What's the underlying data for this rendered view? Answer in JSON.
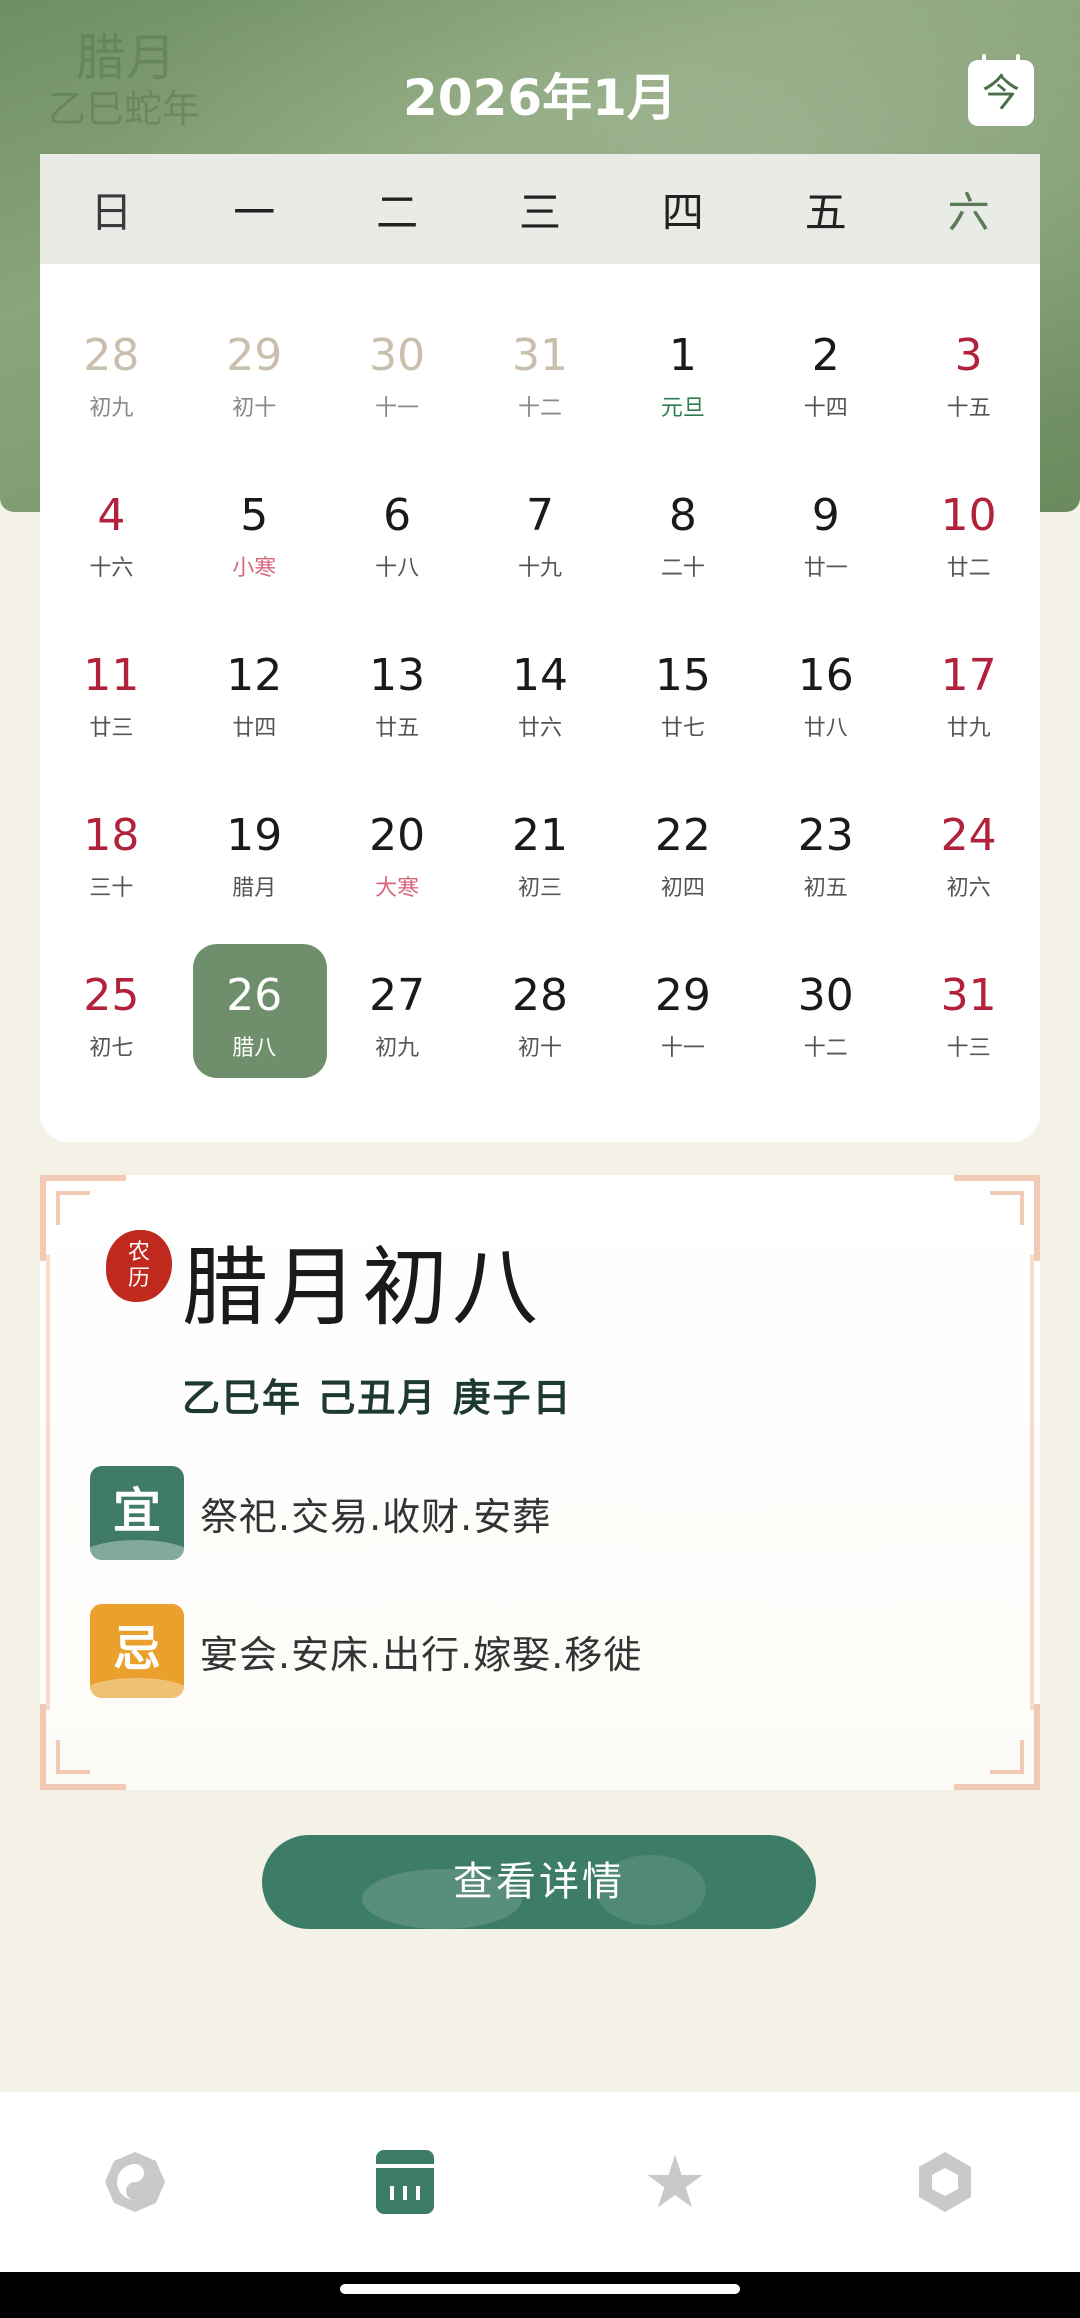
{
  "header": {
    "month_title": "2026年1月",
    "ghost_lunar_line1": "腊月",
    "ghost_lunar_line2": "乙巳蛇年",
    "today_button": "今"
  },
  "weekdays": [
    "日",
    "一",
    "二",
    "三",
    "四",
    "五",
    "六"
  ],
  "calendar": {
    "weeks": [
      [
        {
          "day": "28",
          "lunar": "初九",
          "type": "other"
        },
        {
          "day": "29",
          "lunar": "初十",
          "type": "other"
        },
        {
          "day": "30",
          "lunar": "十一",
          "type": "other"
        },
        {
          "day": "31",
          "lunar": "十二",
          "type": "other"
        },
        {
          "day": "1",
          "lunar": "元旦",
          "type": "holiday"
        },
        {
          "day": "2",
          "lunar": "十四",
          "type": "normal"
        },
        {
          "day": "3",
          "lunar": "十五",
          "type": "weekend"
        }
      ],
      [
        {
          "day": "4",
          "lunar": "十六",
          "type": "weekend"
        },
        {
          "day": "5",
          "lunar": "小寒",
          "type": "term"
        },
        {
          "day": "6",
          "lunar": "十八",
          "type": "normal"
        },
        {
          "day": "7",
          "lunar": "十九",
          "type": "normal"
        },
        {
          "day": "8",
          "lunar": "二十",
          "type": "normal"
        },
        {
          "day": "9",
          "lunar": "廿一",
          "type": "normal"
        },
        {
          "day": "10",
          "lunar": "廿二",
          "type": "weekend"
        }
      ],
      [
        {
          "day": "11",
          "lunar": "廿三",
          "type": "weekend"
        },
        {
          "day": "12",
          "lunar": "廿四",
          "type": "normal"
        },
        {
          "day": "13",
          "lunar": "廿五",
          "type": "normal"
        },
        {
          "day": "14",
          "lunar": "廿六",
          "type": "normal"
        },
        {
          "day": "15",
          "lunar": "廿七",
          "type": "normal"
        },
        {
          "day": "16",
          "lunar": "廿八",
          "type": "normal"
        },
        {
          "day": "17",
          "lunar": "廿九",
          "type": "weekend"
        }
      ],
      [
        {
          "day": "18",
          "lunar": "三十",
          "type": "weekend"
        },
        {
          "day": "19",
          "lunar": "腊月",
          "type": "normal"
        },
        {
          "day": "20",
          "lunar": "大寒",
          "type": "term"
        },
        {
          "day": "21",
          "lunar": "初三",
          "type": "normal"
        },
        {
          "day": "22",
          "lunar": "初四",
          "type": "normal"
        },
        {
          "day": "23",
          "lunar": "初五",
          "type": "normal"
        },
        {
          "day": "24",
          "lunar": "初六",
          "type": "weekend"
        }
      ],
      [
        {
          "day": "25",
          "lunar": "初七",
          "type": "weekend"
        },
        {
          "day": "26",
          "lunar": "腊八",
          "type": "selected"
        },
        {
          "day": "27",
          "lunar": "初九",
          "type": "normal"
        },
        {
          "day": "28",
          "lunar": "初十",
          "type": "normal"
        },
        {
          "day": "29",
          "lunar": "十一",
          "type": "normal"
        },
        {
          "day": "30",
          "lunar": "十二",
          "type": "normal"
        },
        {
          "day": "31",
          "lunar": "十三",
          "type": "weekend"
        }
      ]
    ]
  },
  "detail": {
    "seal_text_1": "农",
    "seal_text_2": "历",
    "lunar_date": "腊月初八",
    "ganzhi": "乙巳年 己丑月 庚子日",
    "yi_label": "宜",
    "yi_text": "祭祀.交易.收财.安葬",
    "ji_label": "忌",
    "ji_text": "宴会.安床.出行.嫁娶.移徙",
    "button_label": "查看详情"
  },
  "tabbar": {
    "tabs": [
      {
        "icon": "bagua-icon",
        "active": false
      },
      {
        "icon": "calendar-icon",
        "active": true
      },
      {
        "icon": "star-icon",
        "active": false
      },
      {
        "icon": "hexagon-icon",
        "active": false
      }
    ]
  },
  "colors": {
    "accent": "#3d7c66",
    "header": "#7d9a6e",
    "weekend_red": "#b3223b",
    "holiday_green": "#2e7d4f",
    "solar_term_pink": "#d9677f",
    "ji_orange": "#e9a02c"
  }
}
